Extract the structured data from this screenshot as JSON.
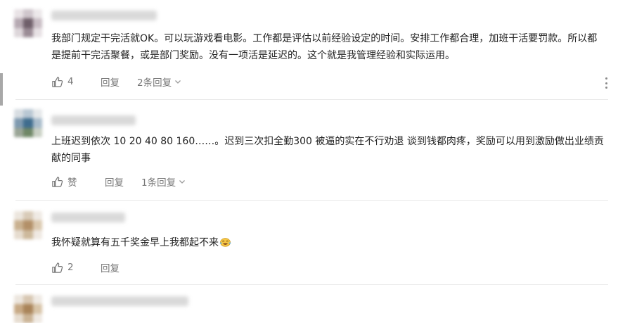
{
  "comments": [
    {
      "text": "我部门规定干完活就OK。可以玩游戏看电影。工作都是评估以前经验设定的时间。安排工作都合理，加班干活要罚款。所以都是提前干完活聚餐，或是部门奖励。没有一项活是延迟的。这个就是我管理经验和实际运用。",
      "likes": "4",
      "reply_label": "回复",
      "replies_label": "2条回复"
    },
    {
      "text": "上班迟到依次 10 20 40 80 160……。迟到三次扣全勤300 被逼的实在不行劝退 谈到钱都肉疼，奖励可以用到激励做出业绩贡献的同事",
      "likes": "赞",
      "reply_label": "回复",
      "replies_label": "1条回复"
    },
    {
      "text": "我怀疑就算有五千奖金早上我都起不来",
      "likes": "2",
      "reply_label": "回复"
    }
  ],
  "icons": {
    "like": "thumbs-up-icon",
    "expand": "chevron-down-icon",
    "more": "more-vertical-icon",
    "emoji": "laughing-crying-emoji-icon"
  },
  "colors": {
    "text": "#222222",
    "muted": "#777777",
    "divider": "#e9e9e9"
  }
}
